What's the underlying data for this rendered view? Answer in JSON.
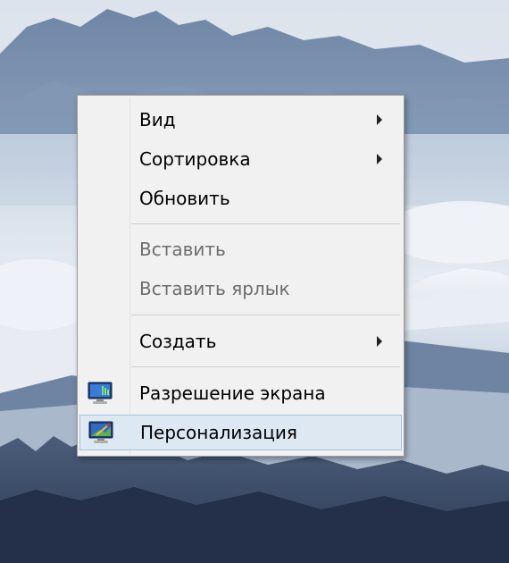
{
  "desktop": {
    "sky_color": "#e3e9f1",
    "mountain_color": "#7288a6",
    "snow_color": "#f4f7fa",
    "forest_color": "#2e3d56"
  },
  "context_menu": {
    "items": [
      {
        "label": "Вид",
        "has_submenu": true,
        "enabled": true
      },
      {
        "label": "Сортировка",
        "has_submenu": true,
        "enabled": true
      },
      {
        "label": "Обновить",
        "has_submenu": false,
        "enabled": true
      },
      {
        "label": "Вставить",
        "has_submenu": false,
        "enabled": false
      },
      {
        "label": "Вставить ярлык",
        "has_submenu": false,
        "enabled": false
      },
      {
        "label": "Создать",
        "has_submenu": true,
        "enabled": true
      },
      {
        "label": "Разрешение экрана",
        "has_submenu": false,
        "enabled": true,
        "icon": "monitor-resolution-icon"
      },
      {
        "label": "Персонализация",
        "has_submenu": false,
        "enabled": true,
        "highlighted": true,
        "icon": "monitor-personalize-icon"
      }
    ]
  }
}
